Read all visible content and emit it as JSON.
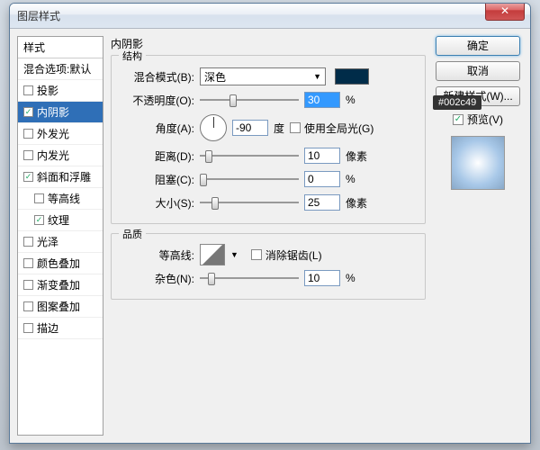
{
  "window": {
    "title": "图层样式"
  },
  "styleList": {
    "header": "样式",
    "blendHeader": "混合选项:默认",
    "items": [
      {
        "label": "投影",
        "checked": false,
        "selected": false
      },
      {
        "label": "内阴影",
        "checked": true,
        "selected": true
      },
      {
        "label": "外发光",
        "checked": false,
        "selected": false
      },
      {
        "label": "内发光",
        "checked": false,
        "selected": false
      },
      {
        "label": "斜面和浮雕",
        "checked": true,
        "selected": false
      },
      {
        "label": "等高线",
        "checked": false,
        "sub": true
      },
      {
        "label": "纹理",
        "checked": true,
        "sub": true
      },
      {
        "label": "光泽",
        "checked": false,
        "selected": false
      },
      {
        "label": "颜色叠加",
        "checked": false,
        "selected": false
      },
      {
        "label": "渐变叠加",
        "checked": false,
        "selected": false
      },
      {
        "label": "图案叠加",
        "checked": false,
        "selected": false
      },
      {
        "label": "描边",
        "checked": false,
        "selected": false
      }
    ]
  },
  "panel": {
    "title": "内阴影",
    "structure": {
      "groupLabel": "结构",
      "blendMode": {
        "label": "混合模式(B):",
        "value": "深色"
      },
      "opacity": {
        "label": "不透明度(O):",
        "value": "30",
        "unit": "%"
      },
      "angle": {
        "label": "角度(A):",
        "value": "-90",
        "unit": "度",
        "global": "使用全局光(G)"
      },
      "distance": {
        "label": "距离(D):",
        "value": "10",
        "unit": "像素"
      },
      "choke": {
        "label": "阻塞(C):",
        "value": "0",
        "unit": "%"
      },
      "size": {
        "label": "大小(S):",
        "value": "25",
        "unit": "像素"
      }
    },
    "quality": {
      "groupLabel": "品质",
      "contour": {
        "label": "等高线:",
        "antialias": "消除锯齿(L)"
      },
      "noise": {
        "label": "杂色(N):",
        "value": "10",
        "unit": "%"
      }
    },
    "colorTooltip": "#002c49",
    "swatchColor": "#002c49"
  },
  "buttons": {
    "ok": "确定",
    "cancel": "取消",
    "newStyle": "新建样式(W)...",
    "preview": "预览(V)"
  }
}
